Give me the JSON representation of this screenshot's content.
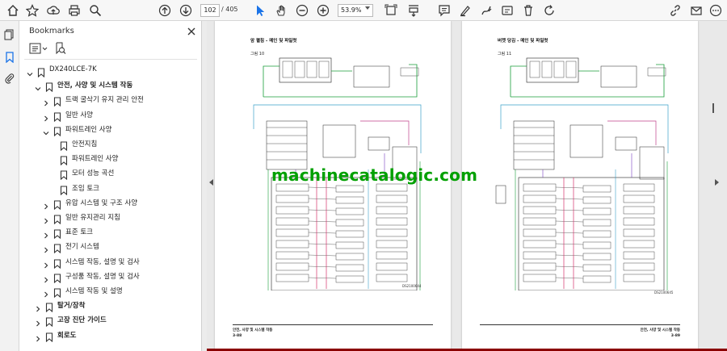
{
  "toolbar": {
    "page_current": "102",
    "page_total": "/ 405",
    "zoom": "53.9%",
    "icons": [
      "home-icon",
      "star-icon",
      "upload-icon",
      "print-icon",
      "zoom-search-icon",
      "prev-page-icon",
      "next-page-icon",
      "select-cursor-icon",
      "hand-icon",
      "zoom-out-icon",
      "zoom-in-icon",
      "fit-page-icon",
      "scroll-mode-icon",
      "comment-icon",
      "highlight-icon",
      "draw-icon",
      "stamp-icon",
      "delete-icon",
      "rotate-icon",
      "link-icon",
      "email-icon",
      "more-icon"
    ]
  },
  "left_rail": {
    "icons": [
      "pages-icon",
      "bookmark-icon",
      "attachment-icon"
    ]
  },
  "bookmarks": {
    "title": "Bookmarks",
    "items": [
      {
        "label": "DX240LCE-7K",
        "level": 0,
        "expanded": true
      },
      {
        "label": "안전, 사양 및 시스템 작동",
        "level": 1,
        "expanded": true,
        "bold": true
      },
      {
        "label": "트랙 굴삭기 유지 관리 안전",
        "level": 2,
        "expanded": false
      },
      {
        "label": "일반 사양",
        "level": 2,
        "expanded": false
      },
      {
        "label": "파워트레인 사양",
        "level": 2,
        "expanded": true
      },
      {
        "label": "안전지침",
        "level": 3
      },
      {
        "label": "파워트레인 사양",
        "level": 3
      },
      {
        "label": "모터 성능 곡선",
        "level": 3
      },
      {
        "label": "조임 토크",
        "level": 3
      },
      {
        "label": "유압 시스템 및 구조 사양",
        "level": 2,
        "expanded": false
      },
      {
        "label": "일반 유지관리 지침",
        "level": 2,
        "expanded": false
      },
      {
        "label": "표준 토크",
        "level": 2,
        "expanded": false
      },
      {
        "label": "전기 시스템",
        "level": 2,
        "expanded": false
      },
      {
        "label": "시스템 작동, 설명 및 검사",
        "level": 2,
        "expanded": false
      },
      {
        "label": "구성품 작동, 설명 및 검사",
        "level": 2,
        "expanded": false
      },
      {
        "label": "시스템 작동 및 설명",
        "level": 2,
        "expanded": false
      },
      {
        "label": "탈거/장착",
        "level": 1,
        "expanded": false,
        "bold": true
      },
      {
        "label": "고장 진단 가이드",
        "level": 1,
        "expanded": false,
        "bold": true
      },
      {
        "label": "회로도",
        "level": 1,
        "expanded": false,
        "bold": true
      }
    ]
  },
  "pages": [
    {
      "header": "암 펼침 - 메인 및 파일럿",
      "figure": "그림 10",
      "code": "DS2100644",
      "footer_title": "안전, 사양 및 시스템 작동",
      "footer_num": "3-88"
    },
    {
      "header": "버켓 당김 - 메인 및 파일럿",
      "figure": "그림 11",
      "code": "DS2100645",
      "footer_title": "안전, 사양 및 시스템 작동",
      "footer_num": "3-89"
    }
  ],
  "watermark": "machinecatalogic.com",
  "colors": {
    "accent": "#1a73e8",
    "watermark": "#00a000"
  }
}
